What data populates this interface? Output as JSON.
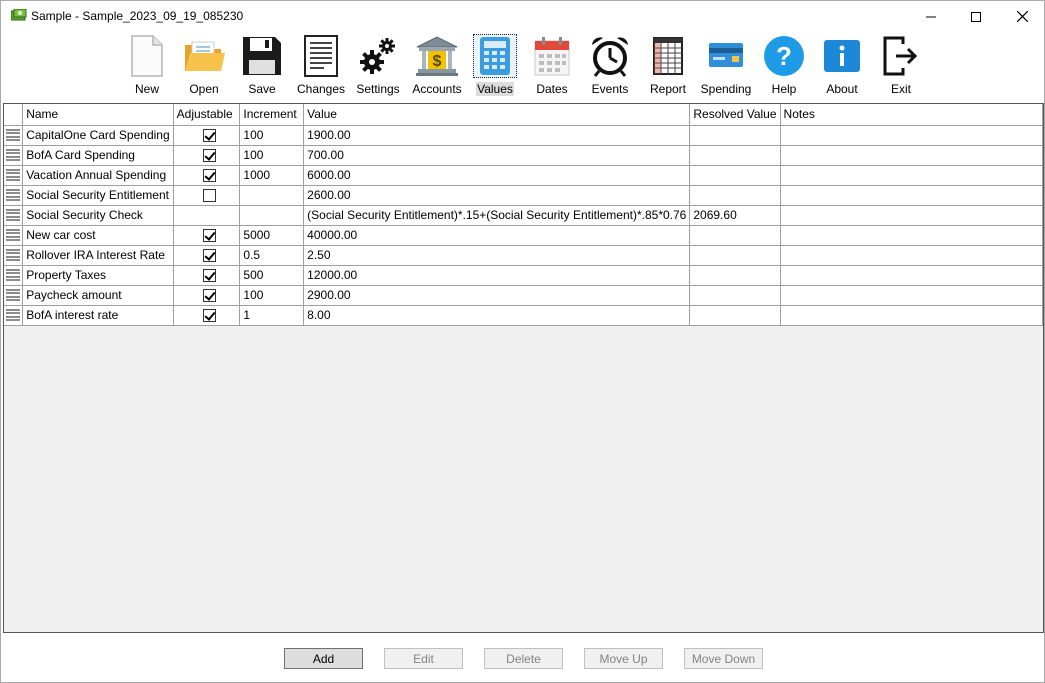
{
  "window": {
    "title": "Sample - Sample_2023_09_19_085230"
  },
  "toolbar": {
    "active": "Values",
    "buttons": [
      {
        "label": "New",
        "icon": "new-document-icon"
      },
      {
        "label": "Open",
        "icon": "open-folder-icon"
      },
      {
        "label": "Save",
        "icon": "floppy-disk-icon"
      },
      {
        "label": "Changes",
        "icon": "changes-document-icon"
      },
      {
        "label": "Settings",
        "icon": "gears-icon"
      },
      {
        "label": "Accounts",
        "icon": "bank-icon"
      },
      {
        "label": "Values",
        "icon": "calculator-icon"
      },
      {
        "label": "Dates",
        "icon": "calendar-icon"
      },
      {
        "label": "Events",
        "icon": "alarm-clock-icon"
      },
      {
        "label": "Report",
        "icon": "spreadsheet-icon"
      },
      {
        "label": "Spending",
        "icon": "credit-card-icon"
      },
      {
        "label": "Help",
        "icon": "help-icon"
      },
      {
        "label": "About",
        "icon": "info-icon"
      },
      {
        "label": "Exit",
        "icon": "exit-icon"
      }
    ]
  },
  "grid": {
    "columns": [
      "Name",
      "Adjustable",
      "Increment",
      "Value",
      "Resolved Value",
      "Notes"
    ],
    "rows": [
      {
        "name": "CapitalOne Card Spending",
        "adjustable": true,
        "increment": "100",
        "value": "1900.00",
        "resolved": "",
        "notes": ""
      },
      {
        "name": "BofA Card Spending",
        "adjustable": true,
        "increment": "100",
        "value": "700.00",
        "resolved": "",
        "notes": ""
      },
      {
        "name": "Vacation Annual Spending",
        "adjustable": true,
        "increment": "1000",
        "value": "6000.00",
        "resolved": "",
        "notes": ""
      },
      {
        "name": "Social Security Entitlement",
        "adjustable": false,
        "increment": "",
        "value": "2600.00",
        "resolved": "",
        "notes": ""
      },
      {
        "name": "Social Security Check",
        "adjustable": null,
        "increment": "",
        "value": "(Social Security Entitlement)*.15+(Social Security Entitlement)*.85*0.76",
        "resolved": "2069.60",
        "notes": ""
      },
      {
        "name": "New car cost",
        "adjustable": true,
        "increment": "5000",
        "value": "40000.00",
        "resolved": "",
        "notes": ""
      },
      {
        "name": "Rollover IRA Interest Rate",
        "adjustable": true,
        "increment": "0.5",
        "value": "2.50",
        "resolved": "",
        "notes": ""
      },
      {
        "name": "Property Taxes",
        "adjustable": true,
        "increment": "500",
        "value": "12000.00",
        "resolved": "",
        "notes": ""
      },
      {
        "name": "Paycheck amount",
        "adjustable": true,
        "increment": "100",
        "value": "2900.00",
        "resolved": "",
        "notes": ""
      },
      {
        "name": "BofA interest rate",
        "adjustable": true,
        "increment": "1",
        "value": "8.00",
        "resolved": "",
        "notes": ""
      }
    ]
  },
  "actions": {
    "add": "Add",
    "edit": "Edit",
    "delete": "Delete",
    "move_up": "Move Up",
    "move_down": "Move Down"
  }
}
